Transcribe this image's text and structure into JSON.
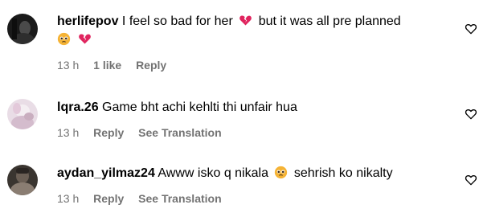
{
  "comments": [
    {
      "username": "herlifepov",
      "text_before": "I feel so bad for her",
      "text_middle": "but it was all pre planned",
      "time": "13 h",
      "likes": "1 like",
      "reply": "Reply"
    },
    {
      "username": "lqra.26",
      "text": "Game bht achi kehlti thi unfair hua",
      "time": "13 h",
      "reply": "Reply",
      "translation": "See Translation"
    },
    {
      "username": "aydan_yilmaz24",
      "text_before": "Awww isko q nikala",
      "text_after": "sehrish ko nikalty",
      "time": "13 h",
      "reply": "Reply",
      "translation": "See Translation"
    }
  ],
  "colors": {
    "text": "#000000",
    "meta": "#737373",
    "heart_emoji": "#e0245e",
    "face_emoji": "#f5b335"
  },
  "icons": {
    "like_button": "heart-outline-icon",
    "broken_heart": "broken-heart-emoji",
    "sad_face": "pleading-face-emoji"
  }
}
